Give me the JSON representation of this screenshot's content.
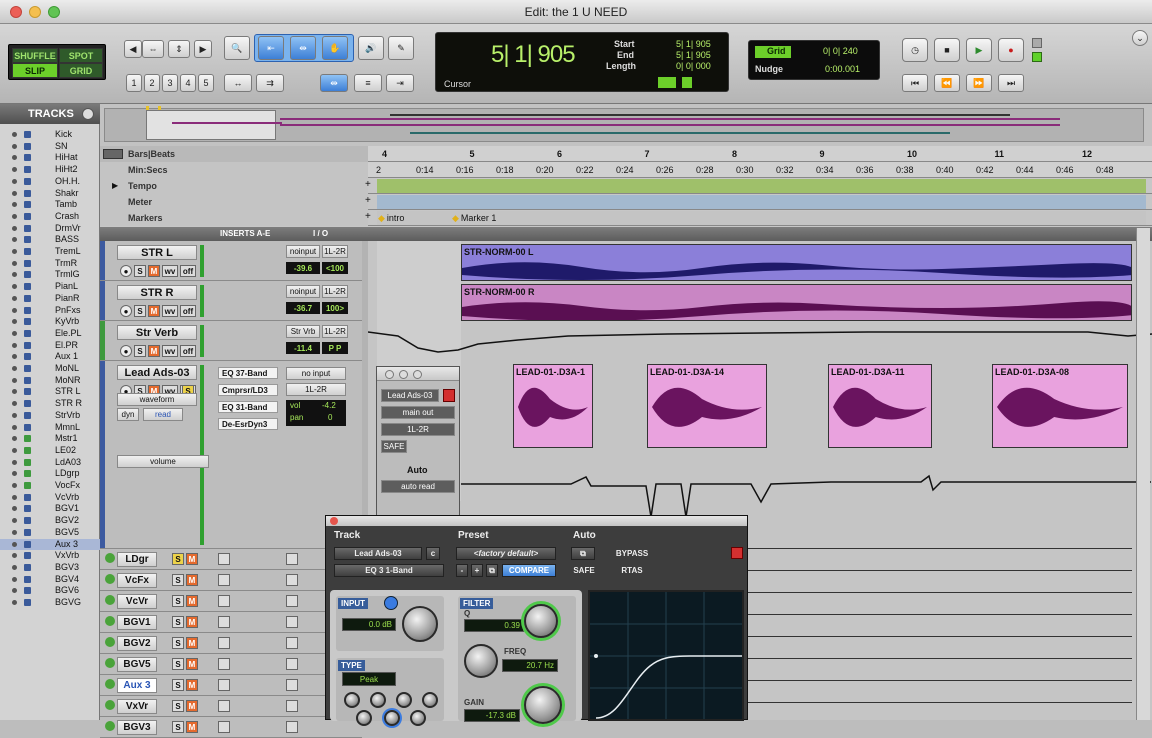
{
  "window": {
    "title": "Edit: the 1 U NEED"
  },
  "toolbar": {
    "modes": [
      "SHUFFLE",
      "SPOT",
      "SLIP",
      "GRID"
    ],
    "zoom_presets": [
      "1",
      "2",
      "3",
      "4",
      "5"
    ],
    "counter": {
      "main": "5| 1| 905",
      "start_label": "Start",
      "end_label": "End",
      "length_label": "Length",
      "start": "5| 1| 905",
      "end": "5| 1| 905",
      "length": "0| 0| 000",
      "cursor_label": "Cursor"
    },
    "grid": {
      "label": "Grid",
      "value": "0| 0| 240",
      "nudge_label": "Nudge",
      "nudge_value": "0:00.001"
    }
  },
  "tracklist": {
    "header": "TRACKS",
    "tracks": [
      "Kick",
      "SN",
      "HiHat",
      "HiHt2",
      "OH.H.",
      "Shakr",
      "Tamb",
      "Crash",
      "DrmVr",
      "BASS",
      "TremL",
      "TrmR",
      "TrmlG",
      "PianL",
      "PianR",
      "PnFxs",
      "KyVrb",
      "Ele.PL",
      "El.PR",
      "Aux 1",
      "MoNL",
      "MoNR",
      "STR L",
      "STR R",
      "StrVrb",
      "MmnL",
      "Mstr1",
      "LE02",
      "LdA03",
      "LDgrp",
      "VocFx",
      "VcVrb",
      "BGV1",
      "BGV2",
      "BGV5",
      "Aux 3",
      "VxVrb",
      "BGV3",
      "BGV4",
      "BGV6",
      "BGVG"
    ]
  },
  "rulers": {
    "bars_label": "Bars|Beats",
    "bars": [
      "4",
      "5",
      "6",
      "7",
      "8",
      "9",
      "10",
      "11",
      "12"
    ],
    "minsecs_label": "Min:Secs",
    "secs": [
      "2",
      "0:14",
      "0:16",
      "0:18",
      "0:20",
      "0:22",
      "0:24",
      "0:26",
      "0:28",
      "0:30",
      "0:32",
      "0:34",
      "0:36",
      "0:38",
      "0:40",
      "0:42",
      "0:44",
      "0:46",
      "0:48"
    ],
    "tempo_label": "Tempo",
    "meter_label": "Meter",
    "markers_label": "Markers",
    "markers": [
      "intro",
      "Marker 1"
    ]
  },
  "columns": {
    "inserts": "INSERTS A-E",
    "io": "I / O"
  },
  "tracks": [
    {
      "name": "STR L",
      "input": "noinput",
      "output": "1L-2R",
      "vol": "-39.6",
      "pan": "<100"
    },
    {
      "name": "STR R",
      "input": "noinput",
      "output": "1L-2R",
      "vol": "-36.7",
      "pan": "100>"
    },
    {
      "name": "Str Verb",
      "input": "Str Vrb",
      "output": "1L-2R",
      "vol": "-11.4",
      "pan": "P  P"
    },
    {
      "name": "Lead Ads-03",
      "input": "no input",
      "output": "1L-2R",
      "view": "waveform",
      "dyn": "dyn",
      "rec": "read",
      "inserts": [
        "EQ 37-Band",
        "Cmprsr/LD3",
        "EQ 31-Band",
        "De-EsrDyn3"
      ],
      "vol_label": "vol",
      "vol": "-4.2",
      "pan_label": "pan",
      "pan": "0",
      "auto": "volume"
    },
    {
      "name": "LDgr"
    },
    {
      "name": "VcFx"
    },
    {
      "name": "VcVr"
    },
    {
      "name": "BGV1"
    },
    {
      "name": "BGV2"
    },
    {
      "name": "BGV5"
    },
    {
      "name": "Aux 3"
    },
    {
      "name": "VxVr"
    },
    {
      "name": "BGV3"
    }
  ],
  "clips": {
    "strl": "STR-NORM-00 L",
    "strr": "STR-NORM-00 R",
    "lead": [
      "LEAD-01-.D3A-1",
      "LEAD-01-.D3A-14",
      "LEAD-01-.D3A-11",
      "LEAD-01-.D3A-08"
    ]
  },
  "mini_window": {
    "track": "Lead Ads-03",
    "out": "main out",
    "bus": "1L-2R",
    "safe": "SAFE",
    "auto_label": "Auto",
    "auto_mode": "auto read"
  },
  "plugin": {
    "track_label": "Track",
    "preset_label": "Preset",
    "auto_label": "Auto",
    "track": "Lead Ads-03",
    "c": "c",
    "preset": "<factory default>",
    "bypass": "BYPASS",
    "plugin_name": "EQ 3 1-Band",
    "compare": "COMPARE",
    "safe": "SAFE",
    "rtas": "RTAS",
    "input_label": "INPUT",
    "input_value": "0.0 dB",
    "filter_label": "FILTER",
    "q_label": "Q",
    "q_value": "0.39",
    "freq_label": "FREQ",
    "freq_value": "20.7 Hz",
    "gain_label": "GAIN",
    "gain_value": "-17.3 dB",
    "type_label": "TYPE",
    "type_value": "Peak"
  }
}
